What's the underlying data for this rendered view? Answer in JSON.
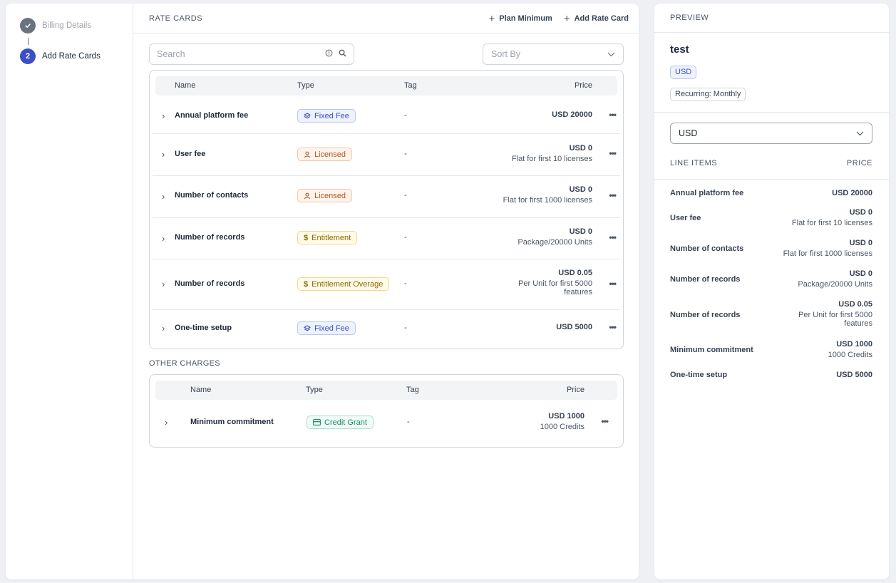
{
  "stepper": {
    "steps": [
      {
        "number": "",
        "label": "Billing Details"
      },
      {
        "number": "2",
        "label": "Add Rate Cards"
      }
    ]
  },
  "rate_cards": {
    "title": "RATE CARDS",
    "plan_minimum_label": "Plan Minimum",
    "add_rate_card_label": "Add Rate Card",
    "search_placeholder": "Search",
    "sort_by_label": "Sort By",
    "columns": {
      "name": "Name",
      "type": "Type",
      "tag": "Tag",
      "price": "Price"
    },
    "rows": [
      {
        "name": "Annual platform fee",
        "type": "Fixed Fee",
        "tag": "-",
        "price": "USD 20000",
        "price_note": ""
      },
      {
        "name": "User fee",
        "type": "Licensed",
        "tag": "-",
        "price": "USD 0",
        "price_note": "Flat for first 10 licenses"
      },
      {
        "name": "Number of contacts",
        "type": "Licensed",
        "tag": "-",
        "price": "USD 0",
        "price_note": "Flat for first 1000 licenses"
      },
      {
        "name": "Number of records",
        "type": "Entitlement",
        "tag": "-",
        "price": "USD 0",
        "price_note": "Package/20000 Units"
      },
      {
        "name": "Number of records",
        "type": "Entitlement Overage",
        "tag": "-",
        "price": "USD 0.05",
        "price_note": "Per Unit for first 5000",
        "price_note2": "features"
      },
      {
        "name": "One-time setup",
        "type": "Fixed Fee",
        "tag": "-",
        "price": "USD 5000",
        "price_note": ""
      }
    ]
  },
  "other_charges": {
    "title": "OTHER CHARGES",
    "columns": {
      "name": "Name",
      "type": "Type",
      "tag": "Tag",
      "price": "Price"
    },
    "rows": [
      {
        "name": "Minimum commitment",
        "type": "Credit Grant",
        "tag": "-",
        "price": "USD 1000",
        "price_note": "1000 Credits"
      }
    ]
  },
  "preview": {
    "title": "PREVIEW",
    "plan_name": "test",
    "currency_badge": "USD",
    "recurring_badge": "Recurring: Monthly",
    "currency_select": "USD",
    "line_items_label": "LINE ITEMS",
    "price_label": "PRICE",
    "line_items": [
      {
        "name": "Annual platform fee",
        "price": "USD 20000",
        "note": ""
      },
      {
        "name": "User fee",
        "price": "USD 0",
        "note": "Flat for first 10 licenses"
      },
      {
        "name": "Number of contacts",
        "price": "USD 0",
        "note": "Flat for first 1000 licenses"
      },
      {
        "name": "Number of records",
        "price": "USD 0",
        "note": "Package/20000 Units"
      },
      {
        "name": "Number of records",
        "price": "USD 0.05",
        "note": "Per Unit for first 5000",
        "note2": "features"
      },
      {
        "name": "Minimum commitment",
        "price": "USD 1000",
        "note": "1000 Credits"
      },
      {
        "name": "One-time setup",
        "price": "USD 5000",
        "note": ""
      }
    ]
  },
  "colors": {
    "accent": "#3b4fc4",
    "fixed_fee": "#3b4fc4",
    "licensed": "#b6531d",
    "entitlement": "#8a6a00",
    "credit_grant": "#1c8a63"
  }
}
